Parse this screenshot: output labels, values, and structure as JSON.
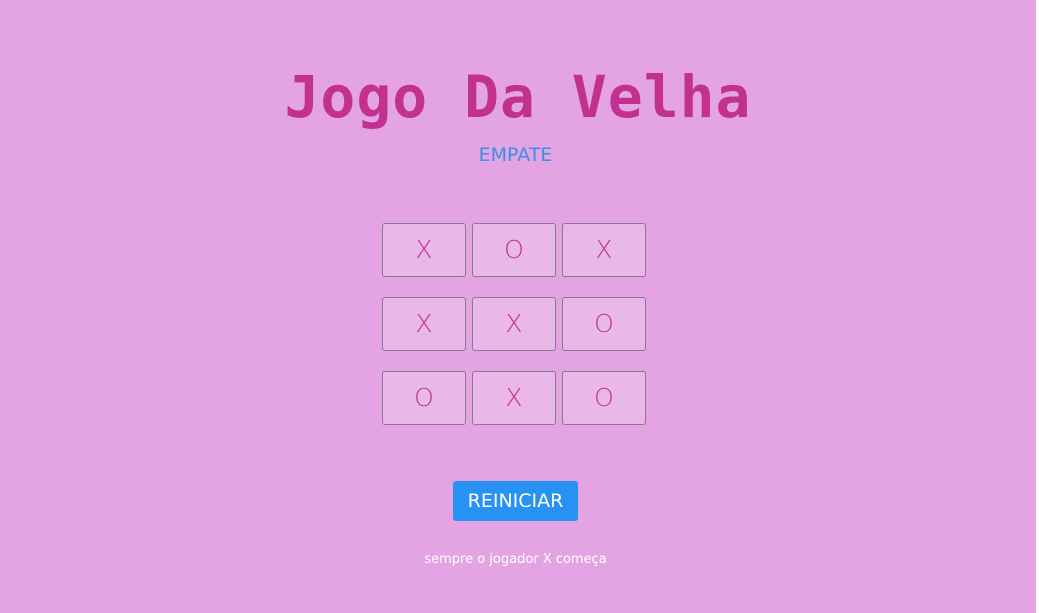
{
  "title": "Jogo Da Velha",
  "status": "EMPATE",
  "board": {
    "cells": [
      "X",
      "O",
      "X",
      "X",
      "X",
      "O",
      "O",
      "X",
      "O"
    ]
  },
  "restart_label": "REINICIAR",
  "footer_note": "sempre o jogador X começa",
  "colors": {
    "background": "#e4a3e3",
    "title": "#c2318f",
    "status": "#3b8fe8",
    "cell_background": "#e9b8e8",
    "mark": "#c2318f",
    "button": "#2791f4"
  }
}
